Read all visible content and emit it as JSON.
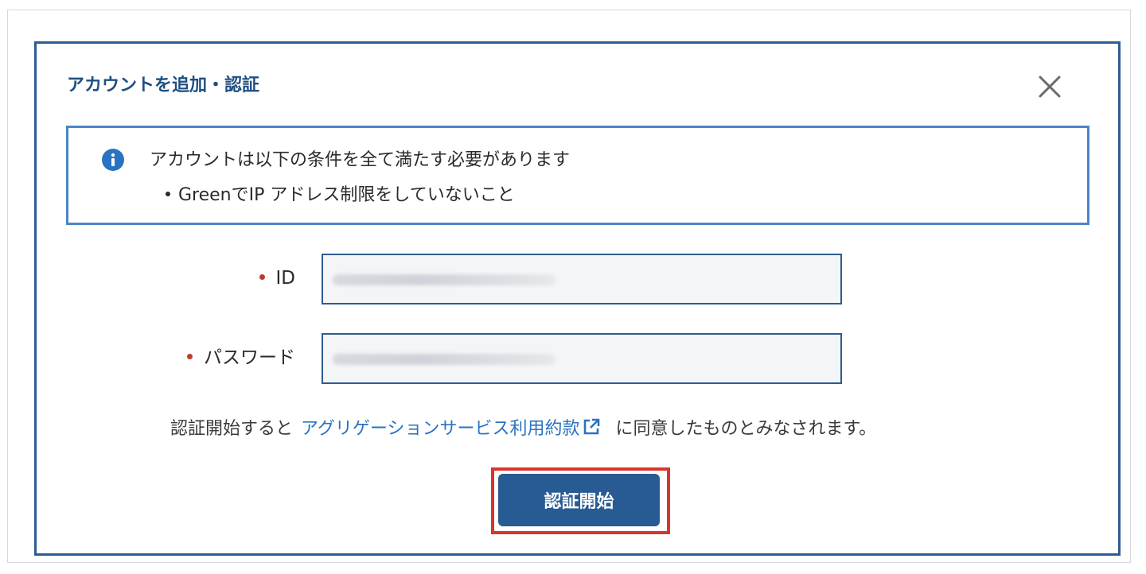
{
  "dialog": {
    "title": "アカウントを追加・認証",
    "close_icon": "close-icon"
  },
  "notice": {
    "icon": "info-icon",
    "message": "アカウントは以下の条件を全て満たす必要があります",
    "conditions": [
      "GreenでIP アドレス制限をしていないこと"
    ]
  },
  "form": {
    "id_label": "ID",
    "password_label": "パスワード",
    "id_value": "",
    "password_value": ""
  },
  "consent": {
    "prefix": "認証開始すると",
    "link_text": "アグリゲーションサービス利用約款",
    "link_icon": "external-link-icon",
    "suffix": "に同意したものとみなされます。"
  },
  "submit": {
    "label": "認証開始"
  },
  "colors": {
    "primary": "#285b93",
    "border": "#2d5c91",
    "notice_border": "#4a86c6",
    "link": "#2a73c2",
    "required": "#c0392b",
    "highlight": "#d9362b"
  }
}
